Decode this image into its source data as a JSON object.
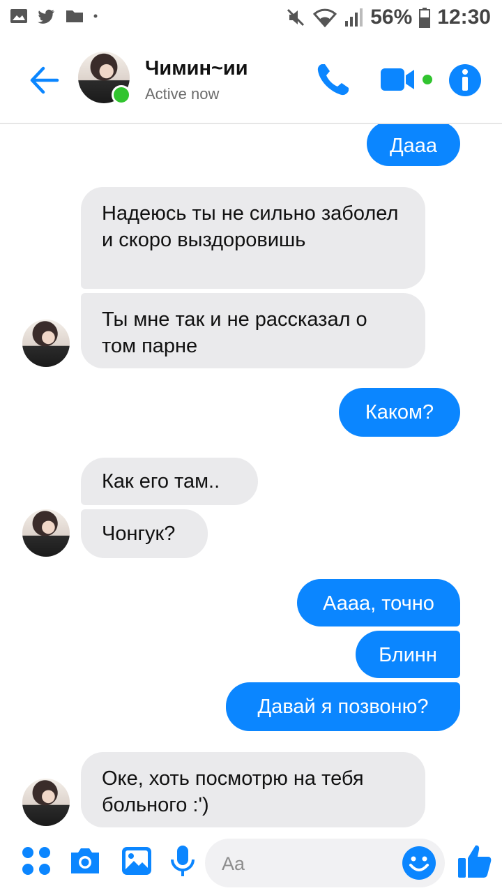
{
  "status_bar": {
    "battery": "56%",
    "time": "12:30"
  },
  "header": {
    "contact_name": "Чимин~ии",
    "contact_status": "Active now"
  },
  "messages": [
    {
      "from": "me",
      "text": "Дааа"
    },
    {
      "from": "them",
      "text": "Надеюсь ты не сильно заболел и скоро выздоровишь"
    },
    {
      "from": "them",
      "text": "Ты мне так и не рассказал о том парне"
    },
    {
      "from": "me",
      "text": "Каком?"
    },
    {
      "from": "them",
      "text": "Как его там.."
    },
    {
      "from": "them",
      "text": "Чонгук?"
    },
    {
      "from": "me",
      "text": "Аааа, точно"
    },
    {
      "from": "me",
      "text": "Блинн"
    },
    {
      "from": "me",
      "text": "Давай я позвоню?"
    },
    {
      "from": "them",
      "text": "Оке, хоть посмотрю на тебя больного :')"
    }
  ],
  "composer": {
    "placeholder": "Aa"
  },
  "colors": {
    "accent": "#0b86ff",
    "incoming_bubble": "#eaeaec",
    "online": "#31c42f"
  }
}
